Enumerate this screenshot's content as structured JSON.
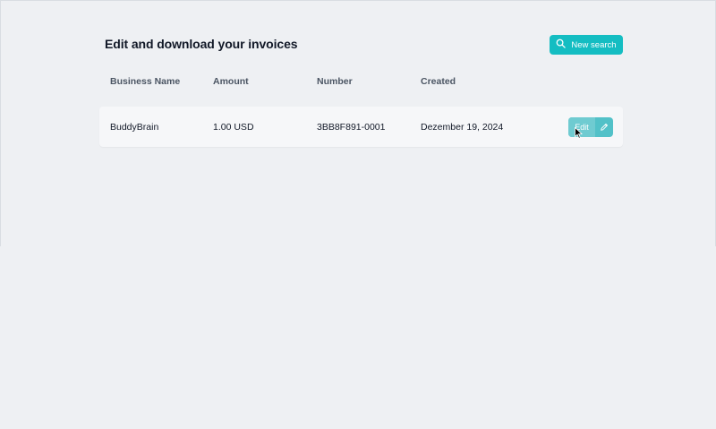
{
  "header": {
    "title": "Edit and download your invoices",
    "new_search_label": "New search",
    "new_search_icon": "search-icon"
  },
  "table": {
    "columns": [
      "Business Name",
      "Amount",
      "Number",
      "Created"
    ],
    "rows": [
      {
        "business_name": "BuddyBrain",
        "amount": "1.00 USD",
        "number": "3BB8F891-0001",
        "created": "Dezember 19, 2024",
        "edit_label": "Edit",
        "edit_icon": "pencil-icon"
      }
    ]
  },
  "colors": {
    "accent": "#14bdc2",
    "edit_button": "#52c1c8",
    "background": "#eef0f3"
  }
}
